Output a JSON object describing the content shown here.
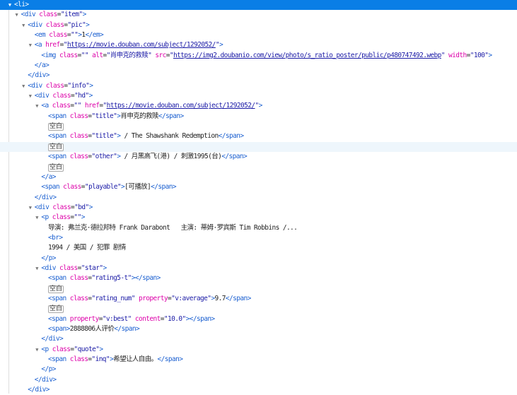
{
  "lines": [
    {
      "indent": 0,
      "arrow": true,
      "state": "sel",
      "tokens": [
        [
          "p",
          "<li>"
        ]
      ]
    },
    {
      "indent": 1,
      "arrow": true,
      "tokens": [
        [
          "p",
          "<div"
        ],
        [
          "a",
          " class"
        ],
        [
          "e",
          "="
        ],
        [
          "v",
          "\"item\""
        ],
        [
          "p",
          ">"
        ]
      ]
    },
    {
      "indent": 2,
      "arrow": true,
      "tokens": [
        [
          "p",
          "<div"
        ],
        [
          "a",
          " class"
        ],
        [
          "e",
          "="
        ],
        [
          "v",
          "\"pic\""
        ],
        [
          "p",
          ">"
        ]
      ]
    },
    {
      "indent": 3,
      "arrow": false,
      "tokens": [
        [
          "p",
          "<em"
        ],
        [
          "a",
          " class"
        ],
        [
          "e",
          "="
        ],
        [
          "v",
          "\"\""
        ],
        [
          "p",
          ">"
        ],
        [
          "x",
          "1"
        ],
        [
          "p",
          "</em>"
        ]
      ]
    },
    {
      "indent": 3,
      "arrow": true,
      "tokens": [
        [
          "p",
          "<a"
        ],
        [
          "a",
          " href"
        ],
        [
          "e",
          "="
        ],
        [
          "v",
          "\""
        ],
        [
          "l",
          "https://movie.douban.com/subject/1292052/"
        ],
        [
          "v",
          "\""
        ],
        [
          "p",
          ">"
        ]
      ]
    },
    {
      "indent": 4,
      "arrow": false,
      "tokens": [
        [
          "p",
          "<img"
        ],
        [
          "a",
          " class"
        ],
        [
          "e",
          "="
        ],
        [
          "v",
          "\"\""
        ],
        [
          "a",
          " alt"
        ],
        [
          "e",
          "="
        ],
        [
          "v",
          "\"肖申克的救赎\""
        ],
        [
          "a",
          " src"
        ],
        [
          "e",
          "="
        ],
        [
          "v",
          "\""
        ],
        [
          "l",
          "https://img2.doubanio.com/view/photo/s_ratio_poster/public/p480747492.webp"
        ],
        [
          "v",
          "\""
        ],
        [
          "a",
          " width"
        ],
        [
          "e",
          "="
        ],
        [
          "v",
          "\"100\""
        ],
        [
          "p",
          ">"
        ]
      ]
    },
    {
      "indent": 3,
      "arrow": false,
      "tokens": [
        [
          "p",
          "</a>"
        ]
      ]
    },
    {
      "indent": 2,
      "arrow": false,
      "tokens": [
        [
          "p",
          "</div>"
        ]
      ]
    },
    {
      "indent": 2,
      "arrow": true,
      "tokens": [
        [
          "p",
          "<div"
        ],
        [
          "a",
          " class"
        ],
        [
          "e",
          "="
        ],
        [
          "v",
          "\"info\""
        ],
        [
          "p",
          ">"
        ]
      ]
    },
    {
      "indent": 3,
      "arrow": true,
      "tokens": [
        [
          "p",
          "<div"
        ],
        [
          "a",
          " class"
        ],
        [
          "e",
          "="
        ],
        [
          "v",
          "\"hd\""
        ],
        [
          "p",
          ">"
        ]
      ]
    },
    {
      "indent": 4,
      "arrow": true,
      "tokens": [
        [
          "p",
          "<a"
        ],
        [
          "a",
          " class"
        ],
        [
          "e",
          "="
        ],
        [
          "v",
          "\"\""
        ],
        [
          "a",
          " href"
        ],
        [
          "e",
          "="
        ],
        [
          "v",
          "\""
        ],
        [
          "l",
          "https://movie.douban.com/subject/1292052/"
        ],
        [
          "v",
          "\""
        ],
        [
          "p",
          ">"
        ]
      ]
    },
    {
      "indent": 5,
      "arrow": false,
      "tokens": [
        [
          "p",
          "<span"
        ],
        [
          "a",
          " class"
        ],
        [
          "e",
          "="
        ],
        [
          "v",
          "\"title\""
        ],
        [
          "p",
          ">"
        ],
        [
          "x",
          "肖申克的救赎"
        ],
        [
          "p",
          "</span>"
        ]
      ]
    },
    {
      "indent": 5,
      "arrow": false,
      "tokens": [
        [
          "w",
          "空白"
        ]
      ]
    },
    {
      "indent": 5,
      "arrow": false,
      "tokens": [
        [
          "p",
          "<span"
        ],
        [
          "a",
          " class"
        ],
        [
          "e",
          "="
        ],
        [
          "v",
          "\"title\""
        ],
        [
          "p",
          ">"
        ],
        [
          "x",
          " / The Shawshank Redemption"
        ],
        [
          "p",
          "</span>"
        ]
      ]
    },
    {
      "indent": 5,
      "arrow": false,
      "state": "hover",
      "tokens": [
        [
          "w",
          "空白"
        ]
      ]
    },
    {
      "indent": 5,
      "arrow": false,
      "tokens": [
        [
          "p",
          "<span"
        ],
        [
          "a",
          " class"
        ],
        [
          "e",
          "="
        ],
        [
          "v",
          "\"other\""
        ],
        [
          "p",
          ">"
        ],
        [
          "x",
          " / 月黑高飞(港) / 刺激1995(台)"
        ],
        [
          "p",
          "</span>"
        ]
      ]
    },
    {
      "indent": 5,
      "arrow": false,
      "tokens": [
        [
          "w",
          "空白"
        ]
      ]
    },
    {
      "indent": 4,
      "arrow": false,
      "tokens": [
        [
          "p",
          "</a>"
        ]
      ]
    },
    {
      "indent": 4,
      "arrow": false,
      "tokens": [
        [
          "p",
          "<span"
        ],
        [
          "a",
          " class"
        ],
        [
          "e",
          "="
        ],
        [
          "v",
          "\"playable\""
        ],
        [
          "p",
          ">"
        ],
        [
          "x",
          "[可播放]"
        ],
        [
          "p",
          "</span>"
        ]
      ]
    },
    {
      "indent": 3,
      "arrow": false,
      "tokens": [
        [
          "p",
          "</div>"
        ]
      ]
    },
    {
      "indent": 3,
      "arrow": true,
      "tokens": [
        [
          "p",
          "<div"
        ],
        [
          "a",
          " class"
        ],
        [
          "e",
          "="
        ],
        [
          "v",
          "\"bd\""
        ],
        [
          "p",
          ">"
        ]
      ]
    },
    {
      "indent": 4,
      "arrow": true,
      "tokens": [
        [
          "p",
          "<p"
        ],
        [
          "a",
          " class"
        ],
        [
          "e",
          "="
        ],
        [
          "v",
          "\"\""
        ],
        [
          "p",
          ">"
        ]
      ]
    },
    {
      "indent": 5,
      "arrow": false,
      "tokens": [
        [
          "x",
          "导演: 弗兰克·德拉邦特 Frank Darabont   主演: 蒂姆·罗宾斯 Tim Robbins /..."
        ]
      ]
    },
    {
      "indent": 5,
      "arrow": false,
      "tokens": [
        [
          "p",
          "<br>"
        ]
      ]
    },
    {
      "indent": 5,
      "arrow": false,
      "tokens": [
        [
          "x",
          "1994 / 美国 / 犯罪 剧情"
        ]
      ]
    },
    {
      "indent": 4,
      "arrow": false,
      "tokens": [
        [
          "p",
          "</p>"
        ]
      ]
    },
    {
      "indent": 4,
      "arrow": true,
      "tokens": [
        [
          "p",
          "<div"
        ],
        [
          "a",
          " class"
        ],
        [
          "e",
          "="
        ],
        [
          "v",
          "\"star\""
        ],
        [
          "p",
          ">"
        ]
      ]
    },
    {
      "indent": 5,
      "arrow": false,
      "tokens": [
        [
          "p",
          "<span"
        ],
        [
          "a",
          " class"
        ],
        [
          "e",
          "="
        ],
        [
          "v",
          "\"rating5-t\""
        ],
        [
          "p",
          ">"
        ],
        [
          "p",
          "</span>"
        ]
      ]
    },
    {
      "indent": 5,
      "arrow": false,
      "tokens": [
        [
          "w",
          "空白"
        ]
      ]
    },
    {
      "indent": 5,
      "arrow": false,
      "tokens": [
        [
          "p",
          "<span"
        ],
        [
          "a",
          " class"
        ],
        [
          "e",
          "="
        ],
        [
          "v",
          "\"rating_num\""
        ],
        [
          "a",
          " property"
        ],
        [
          "e",
          "="
        ],
        [
          "v",
          "\"v:average\""
        ],
        [
          "p",
          ">"
        ],
        [
          "x",
          "9.7"
        ],
        [
          "p",
          "</span>"
        ]
      ]
    },
    {
      "indent": 5,
      "arrow": false,
      "tokens": [
        [
          "w",
          "空白"
        ]
      ]
    },
    {
      "indent": 5,
      "arrow": false,
      "tokens": [
        [
          "p",
          "<span"
        ],
        [
          "a",
          " property"
        ],
        [
          "e",
          "="
        ],
        [
          "v",
          "\"v:best\""
        ],
        [
          "a",
          " content"
        ],
        [
          "e",
          "="
        ],
        [
          "v",
          "\"10.0\""
        ],
        [
          "p",
          ">"
        ],
        [
          "p",
          "</span>"
        ]
      ]
    },
    {
      "indent": 5,
      "arrow": false,
      "tokens": [
        [
          "p",
          "<span>"
        ],
        [
          "x",
          "2888806人评价"
        ],
        [
          "p",
          "</span>"
        ]
      ]
    },
    {
      "indent": 4,
      "arrow": false,
      "tokens": [
        [
          "p",
          "</div>"
        ]
      ]
    },
    {
      "indent": 4,
      "arrow": true,
      "tokens": [
        [
          "p",
          "<p"
        ],
        [
          "a",
          " class"
        ],
        [
          "e",
          "="
        ],
        [
          "v",
          "\"quote\""
        ],
        [
          "p",
          ">"
        ]
      ]
    },
    {
      "indent": 5,
      "arrow": false,
      "tokens": [
        [
          "p",
          "<span"
        ],
        [
          "a",
          " class"
        ],
        [
          "e",
          "="
        ],
        [
          "v",
          "\"inq\""
        ],
        [
          "p",
          ">"
        ],
        [
          "x",
          "希望让人自由。"
        ],
        [
          "p",
          "</span>"
        ]
      ]
    },
    {
      "indent": 4,
      "arrow": false,
      "tokens": [
        [
          "p",
          "</p>"
        ]
      ]
    },
    {
      "indent": 3,
      "arrow": false,
      "tokens": [
        [
          "p",
          "</div>"
        ]
      ]
    },
    {
      "indent": 2,
      "arrow": false,
      "tokens": [
        [
          "p",
          "</div>"
        ]
      ]
    }
  ]
}
